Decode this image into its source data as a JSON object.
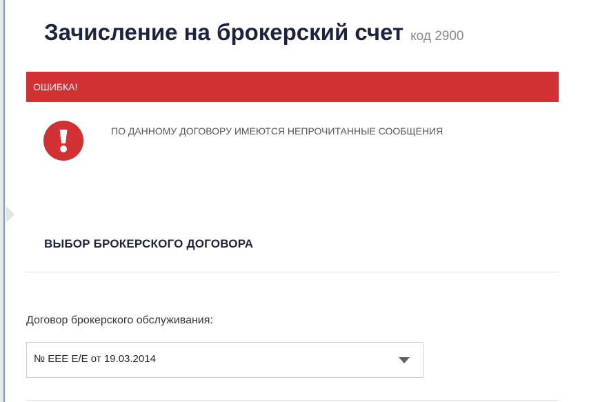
{
  "page": {
    "title": "Зачисление на брокерский счет",
    "code": "код 2900"
  },
  "error": {
    "heading": "ОШИБКА!",
    "message": "ПО ДАННОМУ ДОГОВОРУ ИМЕЮТСЯ НЕПРОЧИТАННЫЕ СООБЩЕНИЯ",
    "icon": "exclamation-circle-icon",
    "color": "#d13133"
  },
  "section": {
    "title": "ВЫБОР БРОКЕРСКОГО ДОГОВОРА"
  },
  "contract_field": {
    "label": "Договор брокерского обслуживания:",
    "selected": "№ ЕЕЕ Е/Е от 19.03.2014",
    "icon": "chevron-down-icon"
  },
  "colors": {
    "heading": "#1c2340",
    "error_red": "#d13133"
  }
}
